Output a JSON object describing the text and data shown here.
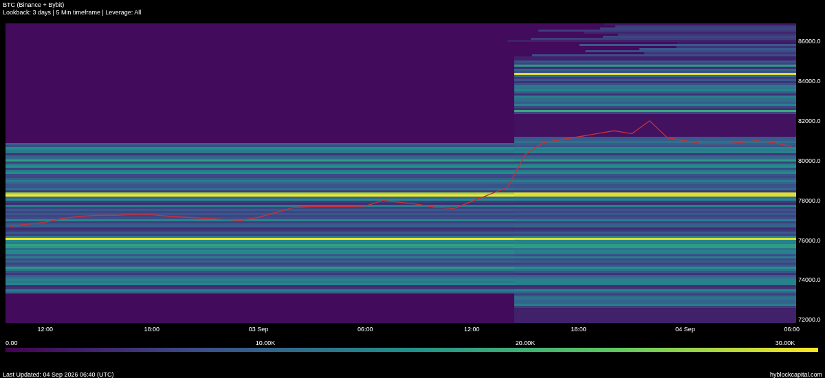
{
  "header": {
    "title": "BTC (Binance + Bybit)",
    "subtitle": "Lookback: 3 days | 5 Min timeframe | Leverage: All"
  },
  "chart": {
    "chart_data": {
      "type": "line",
      "ylim": [
        72000,
        86000
      ],
      "yticks": [
        {
          "value": 86000,
          "label": "86000.0"
        },
        {
          "value": 84000,
          "label": "84000.0"
        },
        {
          "value": 82000,
          "label": "82000.0"
        },
        {
          "value": 80000,
          "label": "80000.0"
        },
        {
          "value": 78000,
          "label": "78000.0"
        },
        {
          "value": 76000,
          "label": "76000.0"
        },
        {
          "value": 74000,
          "label": "74000.0"
        },
        {
          "value": 72000,
          "label": "72000.0"
        }
      ],
      "categories": [
        null,
        null,
        "12:00",
        null,
        null,
        null,
        null,
        null,
        "18:00",
        null,
        null,
        null,
        null,
        null,
        "03 Sep",
        null,
        null,
        null,
        null,
        null,
        "06:00",
        null,
        null,
        null,
        null,
        null,
        "12:00",
        null,
        null,
        null,
        null,
        null,
        "18:00",
        null,
        null,
        null,
        null,
        null,
        "04 Sep",
        null,
        null,
        null,
        null,
        null,
        "06:00"
      ],
      "series": [
        {
          "color": "#c8323a",
          "values": [
            76700,
            76800,
            76900,
            77100,
            77200,
            77250,
            77250,
            77300,
            77280,
            77200,
            77150,
            77100,
            77050,
            77000,
            77150,
            77400,
            77650,
            77700,
            77700,
            77700,
            77720,
            78000,
            77900,
            77800,
            77650,
            77600,
            77950,
            78300,
            78650,
            80300,
            80900,
            81050,
            81200,
            81350,
            81500,
            81350,
            82000,
            81150,
            81000,
            80850,
            80850,
            80900,
            81000,
            80900,
            80700
          ]
        }
      ]
    }
  },
  "colorbar": {
    "ticks": [
      "0.00",
      "10.00K",
      "20.00K",
      "30.00K"
    ]
  },
  "footer": {
    "last_updated": "Last Updated: 04 Sep 2026 06:40 (UTC)",
    "source": "hyblockcapital.com"
  }
}
